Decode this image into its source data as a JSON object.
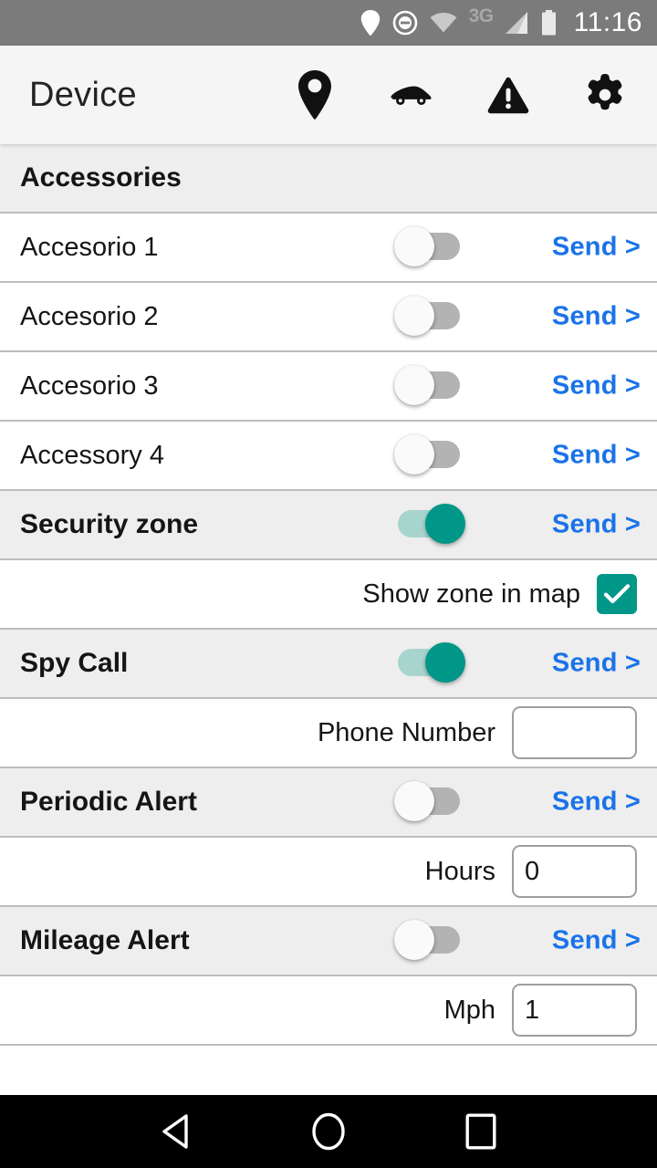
{
  "status_bar": {
    "clock": "11:16",
    "network_label": "3G",
    "icons": [
      "location-pin-icon",
      "do-not-disturb-icon",
      "wifi-icon",
      "signal-bars-icon",
      "battery-icon"
    ],
    "background": "#7b7b7b"
  },
  "app_bar": {
    "title": "Device",
    "background": "#f5f5f5",
    "actions": [
      {
        "name": "location-pin-icon"
      },
      {
        "name": "car-icon"
      },
      {
        "name": "warning-triangle-icon"
      },
      {
        "name": "gear-icon"
      }
    ]
  },
  "colors": {
    "accent_teal": "#009688",
    "track_on": "#a7d5ce",
    "track_off": "#b3b3b3",
    "send_blue": "#1a73e8",
    "row_shaded": "#eeeeee",
    "divider": "#bdbdbd"
  },
  "send_label": "Send >",
  "sections": [
    {
      "header": "Accessories",
      "rows": [
        {
          "label": "Accesorio 1",
          "toggle": "off",
          "send": "Send >"
        },
        {
          "label": "Accesorio 2",
          "toggle": "off",
          "send": "Send >"
        },
        {
          "label": "Accesorio 3",
          "toggle": "off",
          "send": "Send >"
        },
        {
          "label": "Accessory 4",
          "toggle": "off",
          "send": "Send >"
        }
      ]
    }
  ],
  "accessories_header": "Accessories",
  "items": {
    "accessory_1": {
      "label": "Accesorio 1",
      "toggle": "off",
      "send": "Send >"
    },
    "accessory_2": {
      "label": "Accesorio 2",
      "toggle": "off",
      "send": "Send >"
    },
    "accessory_3": {
      "label": "Accesorio 3",
      "toggle": "off",
      "send": "Send >"
    },
    "accessory_4": {
      "label": "Accessory 4",
      "toggle": "off",
      "send": "Send >"
    },
    "security_zone": {
      "label": "Security zone",
      "toggle": "on",
      "send": "Send >"
    },
    "show_zone_in_map": {
      "label": "Show zone in map",
      "checked": true
    },
    "spy_call": {
      "label": "Spy Call",
      "toggle": "on",
      "send": "Send >"
    },
    "phone_number": {
      "label": "Phone Number",
      "value": "",
      "placeholder": ""
    },
    "periodic_alert": {
      "label": "Periodic Alert",
      "toggle": "off",
      "send": "Send >"
    },
    "hours": {
      "label": "Hours",
      "value": "0"
    },
    "mileage_alert": {
      "label": "Mileage Alert",
      "toggle": "off",
      "send": "Send >"
    },
    "mph": {
      "label": "Mph",
      "value": "1"
    }
  },
  "nav_bar": {
    "back": "back-triangle-icon",
    "home": "home-circle-icon",
    "recents": "recents-square-icon"
  }
}
